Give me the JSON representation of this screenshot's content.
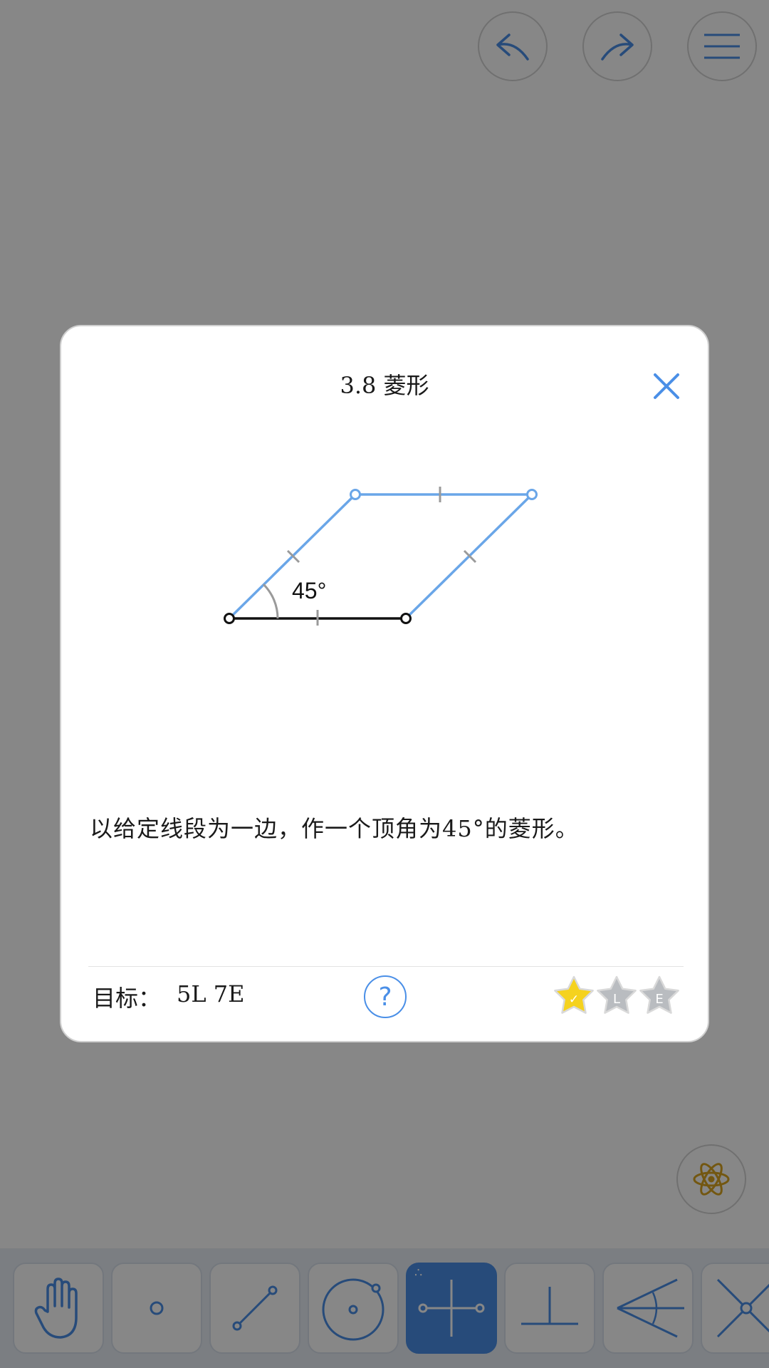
{
  "toolbar_top": {
    "undo_icon": "undo-arrow-icon",
    "redo_icon": "redo-arrow-icon",
    "menu_icon": "hamburger-menu-icon"
  },
  "tools": [
    {
      "name": "hand-tool",
      "icon": "hand-icon"
    },
    {
      "name": "point-tool",
      "icon": "point-icon"
    },
    {
      "name": "segment-tool",
      "icon": "line-segment-icon"
    },
    {
      "name": "circle-tool",
      "icon": "circle-icon"
    },
    {
      "name": "perpendicular-bisector-tool",
      "icon": "perpendicular-bisector-icon",
      "active": true,
      "badge": "∴"
    },
    {
      "name": "perpendicular-tool",
      "icon": "perpendicular-icon"
    },
    {
      "name": "angle-bisector-tool",
      "icon": "angle-bisector-icon"
    },
    {
      "name": "intersect-tool",
      "icon": "intersect-icon"
    }
  ],
  "dialog": {
    "title": "3.8 菱形",
    "angle_label": "45°",
    "description": "以给定线段为一边，作一个顶角为45°的菱形。",
    "goal_label": "目标：",
    "goal_value": "5L 7E",
    "help_label": "?",
    "stars": [
      {
        "state": "earned",
        "label": "✓",
        "color": "#f5d21e"
      },
      {
        "state": "unearned",
        "label": "L",
        "color": "#b9bcc0"
      },
      {
        "state": "unearned",
        "label": "E",
        "color": "#b9bcc0"
      }
    ]
  },
  "colors": {
    "accent": "#4a8fe7",
    "star_gold": "#f5d21e",
    "star_gray": "#b9bcc0",
    "atom": "#d9a520"
  }
}
